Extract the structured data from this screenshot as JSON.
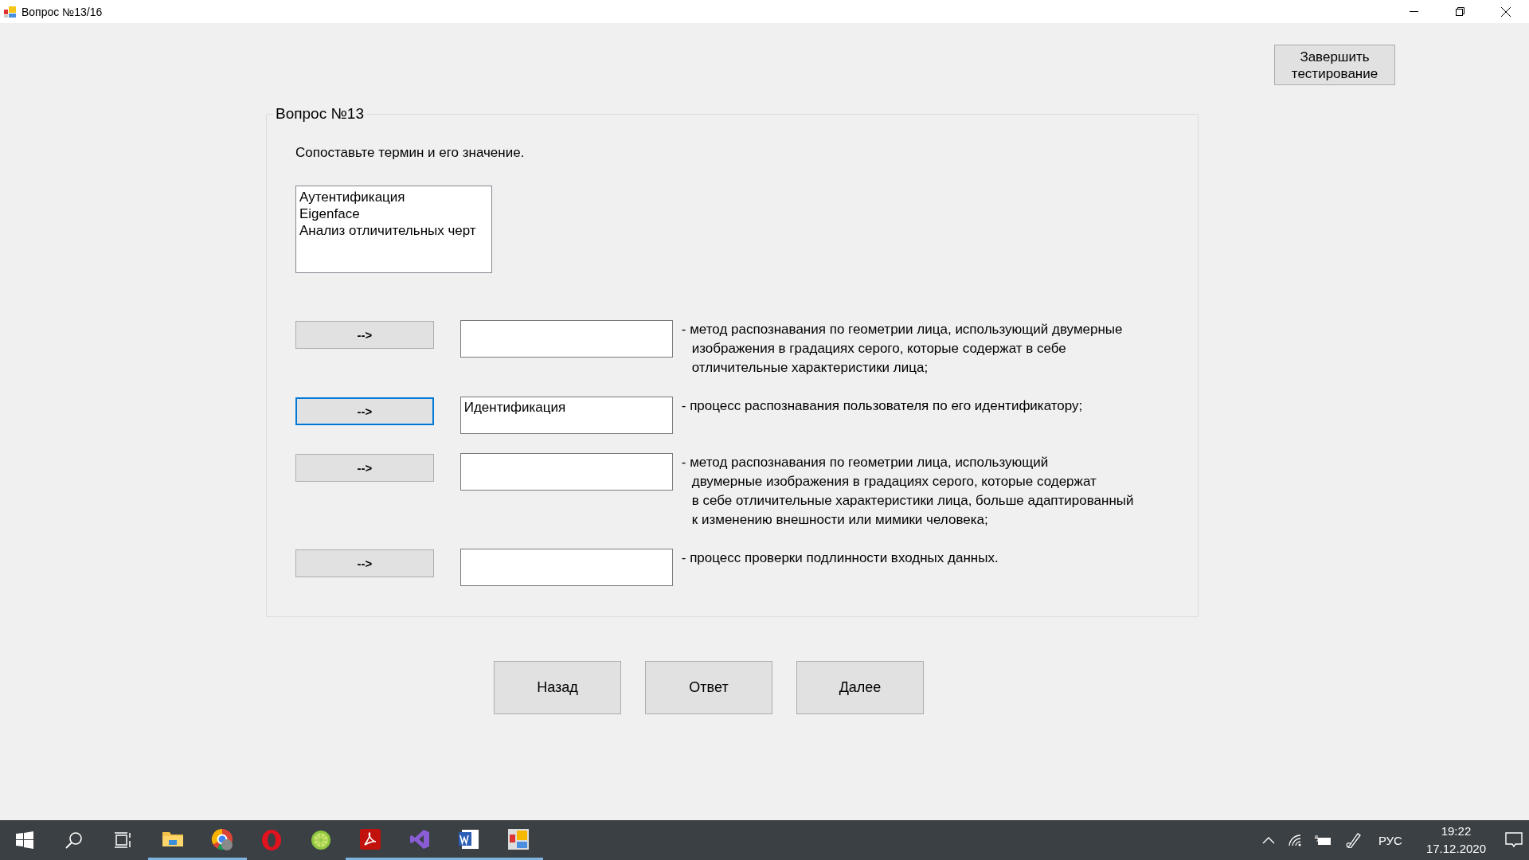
{
  "window": {
    "title": "Вопрос №13/16"
  },
  "finish_button": "Завершить\nтестирование",
  "question": {
    "title": "Вопрос №13",
    "instruction": "Сопоставьте термин и его значение.",
    "terms": [
      "Аутентификация",
      "Eigenface",
      "Анализ отличительных черт"
    ],
    "rows": [
      {
        "button": "-->",
        "focused": false,
        "answer": "",
        "description": "- метод распознавания по геометрии лица, использующий двумерные\nизображения в градациях серого, которые содержат в себе\nотличительные характеристики лица;"
      },
      {
        "button": "-->",
        "focused": true,
        "answer": "Идентификация",
        "description": "- процесс распознавания пользователя по его идентификатору;"
      },
      {
        "button": "-->",
        "focused": false,
        "answer": "",
        "description": "- метод распознавания по геометрии лица, использующий\nдвумерные изображения в градациях серого, которые содержат\nв себе отличительные характеристики лица, больше адаптированный\nк изменению внешности или мимики человека;"
      },
      {
        "button": "-->",
        "focused": false,
        "answer": "",
        "description": "- процесс проверки подлинности входных данных."
      }
    ]
  },
  "nav_buttons": [
    "Назад",
    "Ответ",
    "Далее"
  ],
  "taskbar": {
    "apps": [
      {
        "kind": "explorer",
        "running": true
      },
      {
        "kind": "chrome",
        "running": true
      },
      {
        "kind": "opera",
        "running": false
      },
      {
        "kind": "lime",
        "running": false
      },
      {
        "kind": "acrobat",
        "running": true
      },
      {
        "kind": "vs",
        "running": true
      },
      {
        "kind": "word",
        "running": true
      },
      {
        "kind": "tiles",
        "running": true
      }
    ],
    "language": "РУС",
    "time": "19:22",
    "date": "17.12.2020"
  }
}
